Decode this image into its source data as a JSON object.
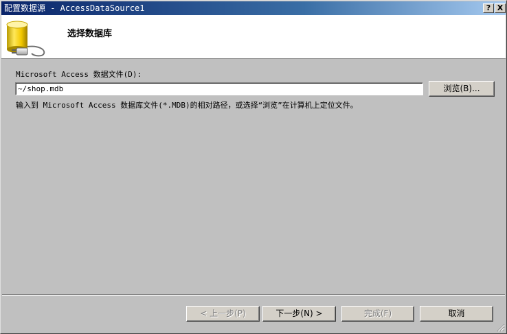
{
  "window": {
    "title": "配置数据源 - AccessDataSource1"
  },
  "titlebar_buttons": {
    "help": "?",
    "close": "X"
  },
  "header": {
    "title": "选择数据库",
    "icon": "database-plug-icon"
  },
  "form": {
    "file_label": "Microsoft Access 数据文件(D):",
    "file_value": "~/shop.mdb",
    "browse_label": "浏览(B)...",
    "help_text": "输入到 Microsoft Access 数据库文件(*.MDB)的相对路径，或选择“浏览”在计算机上定位文件。"
  },
  "footer": {
    "prev_label": "< 上一步(P)",
    "next_label": "下一步(N) >",
    "finish_label": "完成(F)",
    "cancel_label": "取消"
  },
  "colors": {
    "dialog_bg": "#c0c0c0",
    "titlebar_start": "#0a246a",
    "titlebar_end": "#a6caf0",
    "header_bg": "#ffffff"
  }
}
